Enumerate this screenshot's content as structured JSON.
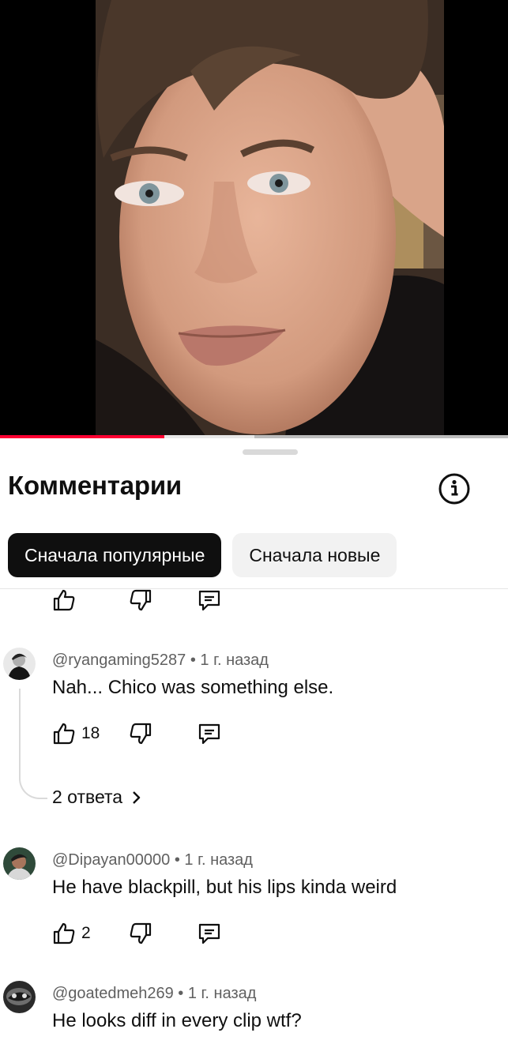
{
  "video": {
    "progress_fraction": 0.323,
    "buffer_fraction": 0.5
  },
  "comments_panel": {
    "title": "Комментарии",
    "info_icon": "info-circle-icon",
    "sort_chips": [
      {
        "label": "Сначала популярные",
        "active": true
      },
      {
        "label": "Сначала новые",
        "active": false
      }
    ]
  },
  "comments": [
    {
      "author": "@ryangaming5287",
      "time": "1 г. назад",
      "text": "Nah... Chico was something else.",
      "likes": "18",
      "replies_label": "2 ответа"
    },
    {
      "author": "@Dipayan00000",
      "time": "1 г. назад",
      "text": "He have blackpill, but his lips kinda weird",
      "likes": "2"
    },
    {
      "author": "@goatedmeh269",
      "time": "1 г. назад",
      "text": "He looks diff in every clip wtf?"
    }
  ],
  "meta_separator": " • ",
  "colors": {
    "accent_progress": "#ff0033",
    "chip_active_bg": "#0f0f0f",
    "chip_inactive_bg": "#f2f2f2",
    "meta_text": "#606060"
  }
}
